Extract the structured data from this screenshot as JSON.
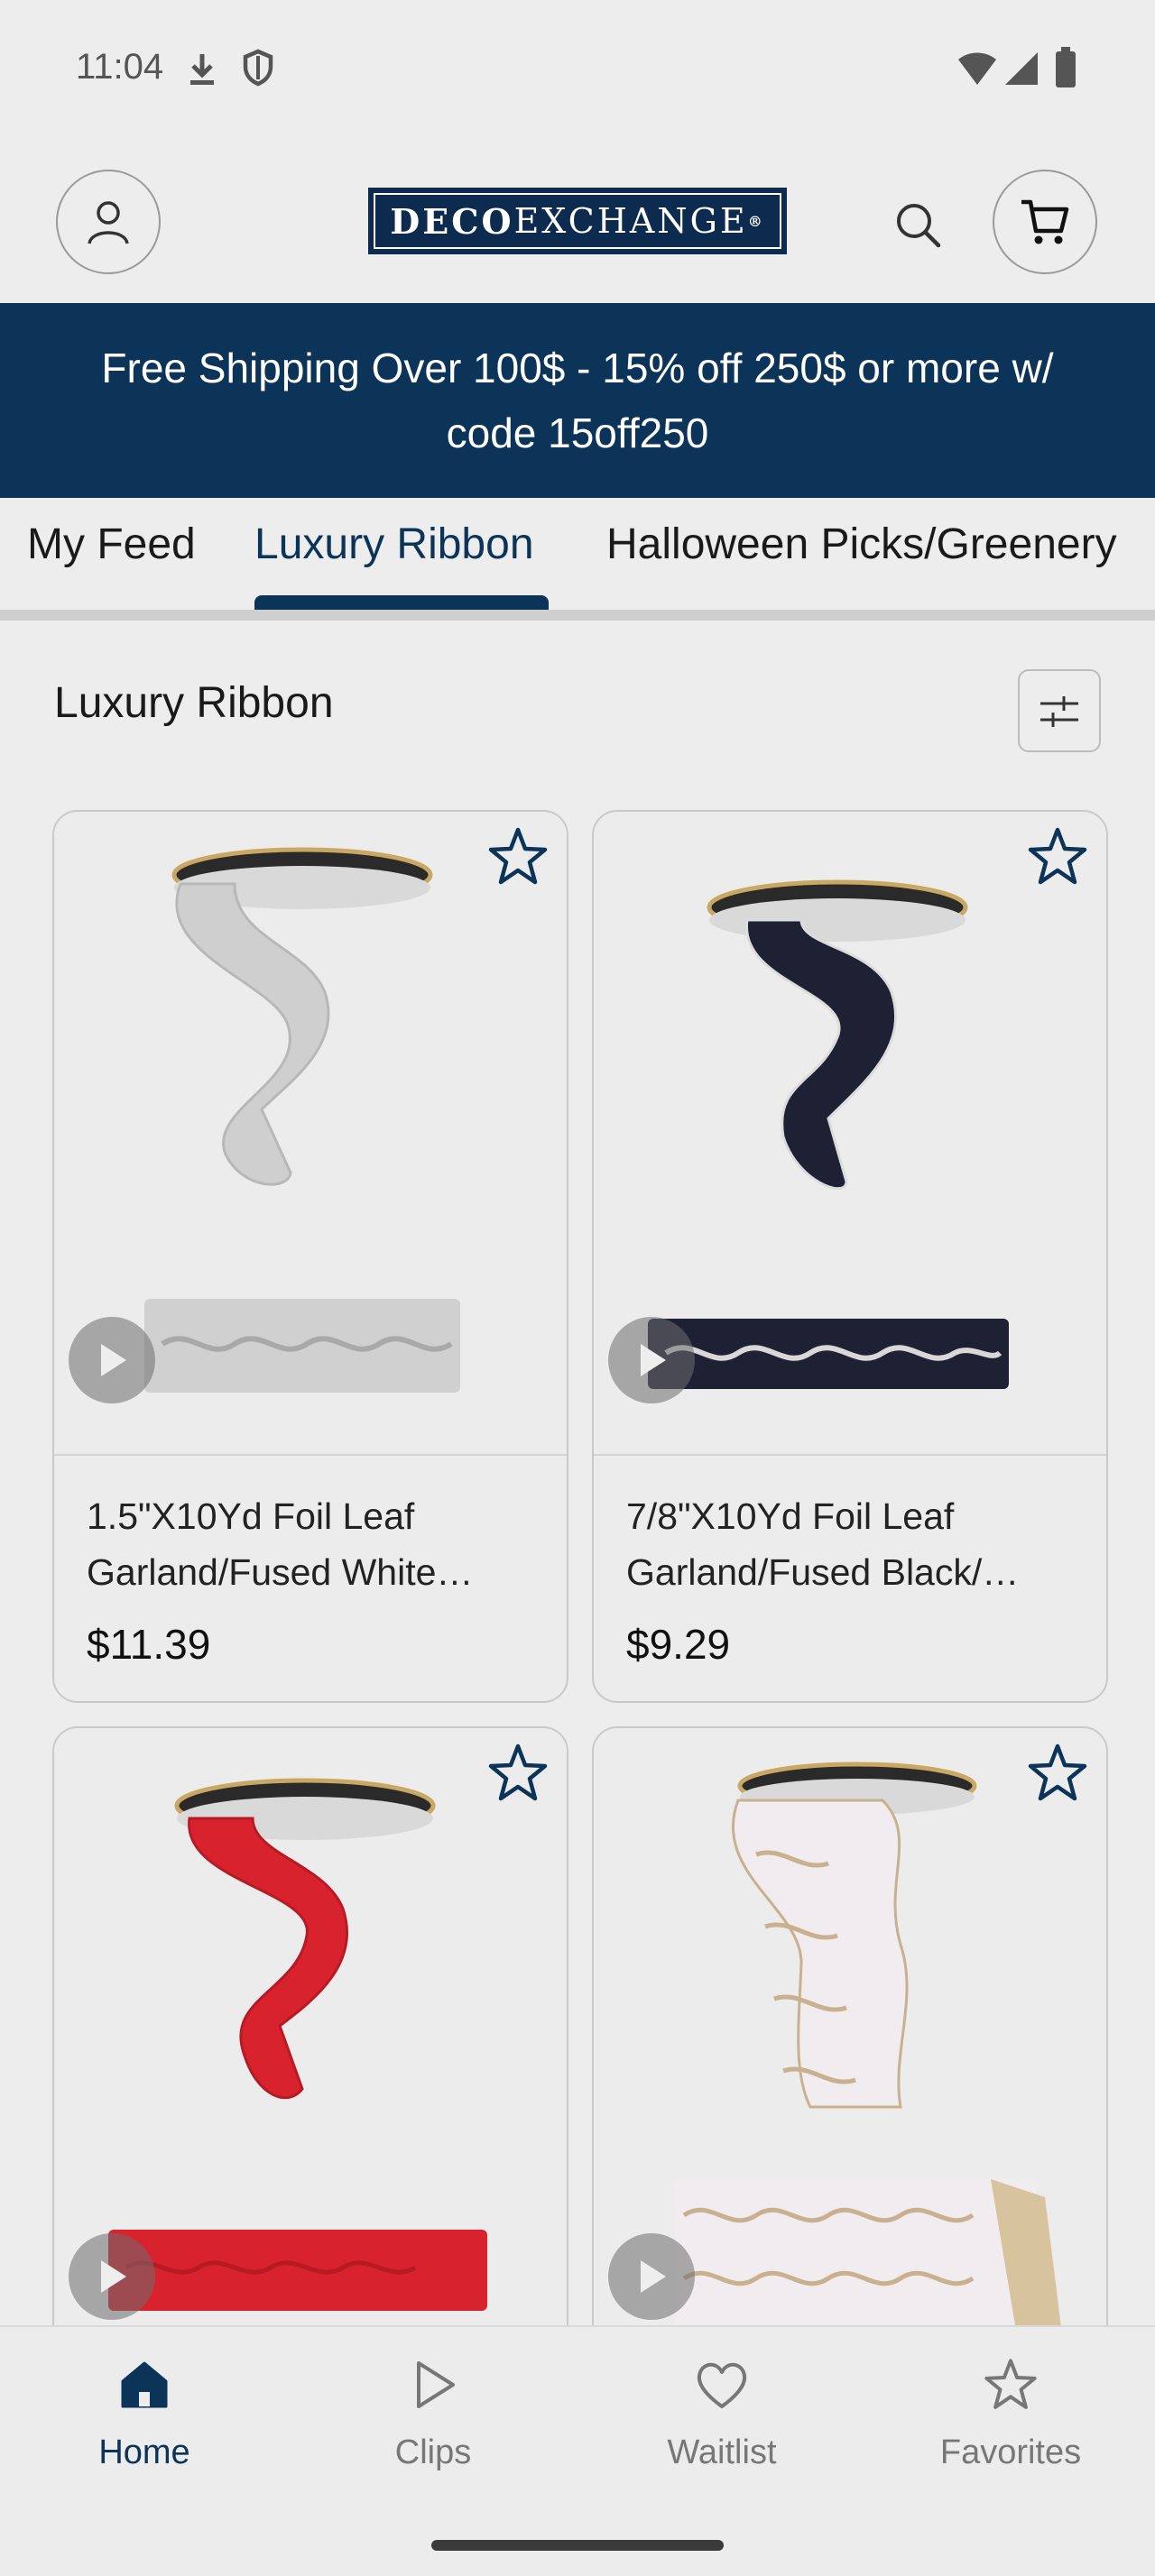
{
  "status_bar": {
    "time": "11:04"
  },
  "header": {
    "logo_text_bold": "DECO",
    "logo_text_light": "EXCHANGE",
    "logo_mark": "®"
  },
  "promo": {
    "text": "Free Shipping Over 100$ - 15% off 250$ or more w/ code 15off250"
  },
  "tabs": [
    {
      "label": "My Feed",
      "active": false
    },
    {
      "label": "Luxury Ribbon",
      "active": true
    },
    {
      "label": "Halloween Picks/Greenery",
      "active": false
    }
  ],
  "section": {
    "title": "Luxury Ribbon"
  },
  "products": [
    {
      "name": "1.5\"X10Yd Foil Leaf Garland/Fused White…",
      "price": "$11.39",
      "ribbon_color": "#cfcfcf",
      "leaf_color": "#a9a9a9"
    },
    {
      "name": "7/8\"X10Yd Foil Leaf Garland/Fused Black/…",
      "price": "$9.29",
      "ribbon_color": "#1e2033",
      "leaf_color": "#d8d8d8"
    },
    {
      "name": "",
      "price": "",
      "ribbon_color": "#d8232f",
      "leaf_color": "#b81a24"
    },
    {
      "name": "",
      "price": "",
      "ribbon_color": "#f1ecef",
      "leaf_color": "#c9b08e"
    }
  ],
  "bottom_nav": [
    {
      "label": "Home",
      "icon": "home-icon",
      "active": true
    },
    {
      "label": "Clips",
      "icon": "play-icon",
      "active": false
    },
    {
      "label": "Waitlist",
      "icon": "heart-icon",
      "active": false
    },
    {
      "label": "Favorites",
      "icon": "star-icon",
      "active": false
    }
  ],
  "colors": {
    "brand": "#0b3458",
    "background": "#ededed"
  }
}
